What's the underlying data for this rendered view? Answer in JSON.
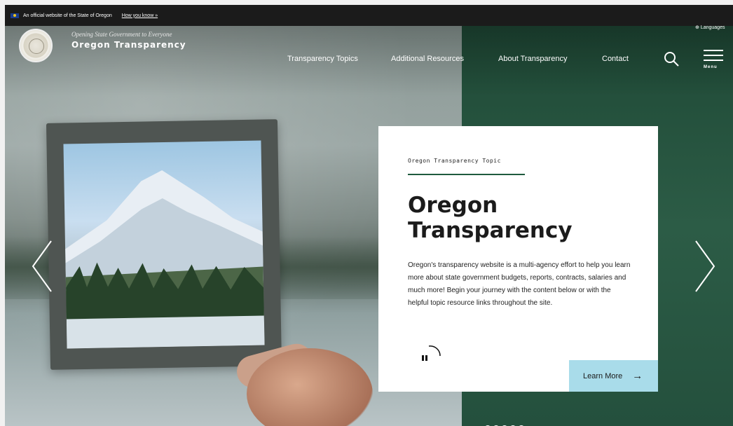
{
  "banner": {
    "text": "An official website of the State of Oregon",
    "link": "How you know »"
  },
  "header": {
    "tagline": "Opening State Government to Everyone",
    "site_name": "Oregon Transparency",
    "languages": "Languages",
    "menu_label": "Menu"
  },
  "nav": [
    {
      "label": "Transparency Topics"
    },
    {
      "label": "Additional Resources"
    },
    {
      "label": "About Transparency"
    },
    {
      "label": "Contact"
    }
  ],
  "hero": {
    "kicker": "Oregon Transparency Topic",
    "title": "Oregon Transparency",
    "description": "Oregon's transparency website is a multi-agency effort to help you learn more about state government budgets, reports, contracts, salaries and much more!  Begin your journey with the content below or with the helpful topic resource links throughout the site.",
    "cta": "Learn More",
    "slide_count": 5,
    "active_slide": 1
  },
  "icons": {
    "search": "search-icon",
    "menu": "hamburger-icon",
    "globe": "globe-icon",
    "prev": "chevron-left-icon",
    "next": "chevron-right-icon",
    "pause": "pause-icon",
    "arrow": "arrow-right-icon"
  },
  "colors": {
    "green": "#24503d",
    "cta": "#a9dcea",
    "banner": "#1b1b1b"
  }
}
